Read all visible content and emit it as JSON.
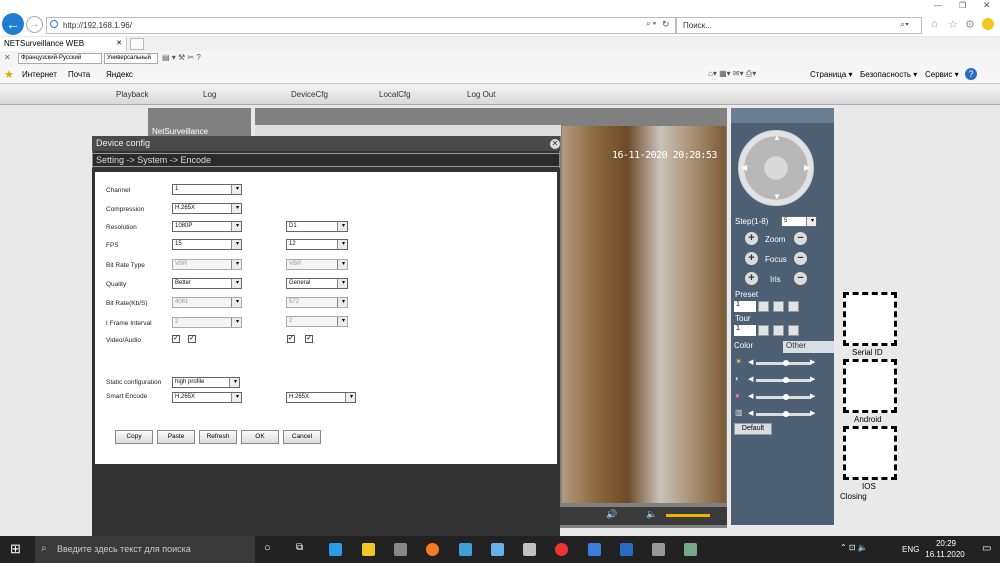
{
  "browser": {
    "url": "http://192.168.1.96/",
    "search_placeholder": "Поиск...",
    "tab_title": "NETSurveillance WEB",
    "lang_select": "Французский-Русский",
    "mode_select": "Универсальный",
    "favorites": [
      "Интернет",
      "Почта",
      "Яндекс"
    ],
    "menus": [
      "Страница",
      "Безопасность",
      "Сервис"
    ]
  },
  "nav": [
    "Playback",
    "Log",
    "DeviceCfg",
    "LocalCfg",
    "Log Out"
  ],
  "sidebar_header": "NetSurveillance",
  "timestamp": "16-11-2020 20:28:53",
  "dialog": {
    "title": "Device config",
    "breadcrumb": "Setting -> System -> Encode",
    "fields": [
      {
        "label": "Channel",
        "main": "1"
      },
      {
        "label": "Compression",
        "main": "H.265X"
      },
      {
        "label": "Resolution",
        "main": "1080P",
        "extra": "D1"
      },
      {
        "label": "FPS",
        "main": "15",
        "extra": "12"
      },
      {
        "label": "Bit Rate Type",
        "main": "VBR",
        "extra": "VBR"
      },
      {
        "label": "Quality",
        "main": "Better",
        "extra": "General"
      },
      {
        "label": "Bit Rate(Kb/S)",
        "main": "4061",
        "extra": "572"
      },
      {
        "label": "I Frame Interval",
        "main": "2",
        "extra": "2"
      },
      {
        "label": "Video/Audio"
      },
      {
        "label": "Static configuration",
        "main": "high profile"
      },
      {
        "label": "Smart Encode",
        "main": "H.265X",
        "extra": "H.265X"
      }
    ],
    "buttons": [
      "Copy",
      "Paste",
      "Refresh",
      "OK",
      "Cancel"
    ]
  },
  "ptz": {
    "step_label": "Step(1-8)",
    "step_value": "5",
    "zoom": "Zoom",
    "focus": "Focus",
    "iris": "Iris",
    "preset": "Preset",
    "preset_value": "1",
    "tour": "Tour",
    "tour_value": "1",
    "tab_color": "Color",
    "tab_other": "Other",
    "default_btn": "Default",
    "color_levels": [
      0.55,
      0.55,
      0.55,
      0.55
    ]
  },
  "qr": [
    "Serial ID",
    "Android",
    "IOS",
    "Closing"
  ],
  "taskbar": {
    "search": "Введите здесь текст для поиска",
    "lang": "ENG",
    "time": "20:29",
    "date": "16.11.2020"
  }
}
